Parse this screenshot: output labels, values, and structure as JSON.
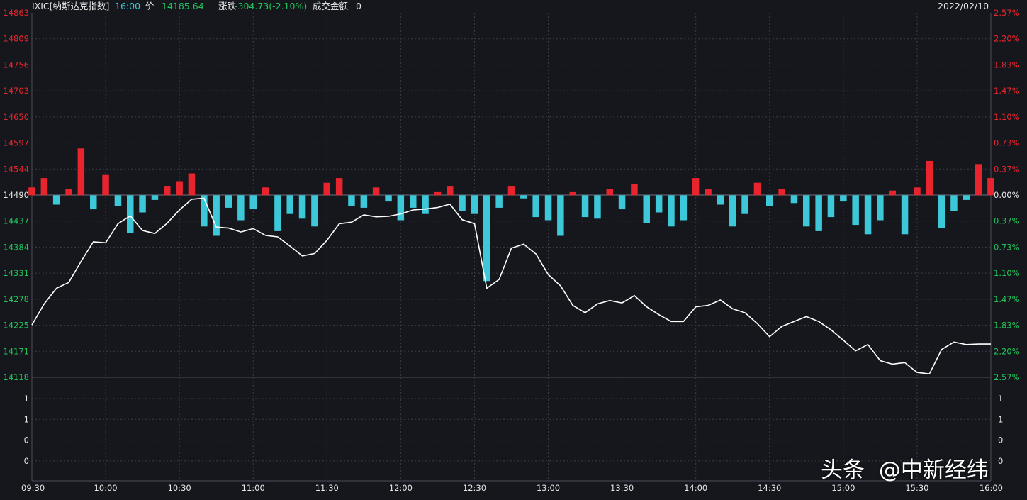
{
  "header": {
    "symbol": "IXIC[纳斯达克指数]",
    "time": "16:00",
    "price_label": "价",
    "price": "14185.64",
    "change_label": "涨跌",
    "change": "-304.73(-2.10%)",
    "turnover_label": "成交金额",
    "turnover": "0",
    "date": "2022/02/10"
  },
  "watermark": {
    "brand": "头条",
    "author": "@中新经纬"
  },
  "colors": {
    "background": "#15171c",
    "up": "#e8252e",
    "down": "#3cc8d8",
    "price_line": "#ffffff",
    "rise_text": "#e8252e",
    "fall_text": "#21c45a",
    "grid": "#3a3f48"
  },
  "chart_data": {
    "type": "line",
    "title": "IXIC[纳斯达克指数]",
    "prev_close": 14490,
    "ylim": [
      14118,
      14863
    ],
    "y_ticks": [
      "14863",
      "14809",
      "14756",
      "14703",
      "14650",
      "14597",
      "14544",
      "14490",
      "14437",
      "14384",
      "14331",
      "14278",
      "14225",
      "14171",
      "14118"
    ],
    "pct_ticks": [
      "2.57%",
      "2.20%",
      "1.83%",
      "1.47%",
      "1.10%",
      "0.73%",
      "0.37%",
      "0.00%",
      "0.37%",
      "0.73%",
      "1.10%",
      "1.47%",
      "1.83%",
      "2.20%",
      "2.57%"
    ],
    "x_ticks": [
      "09:30",
      "10:00",
      "10:30",
      "11:00",
      "11:30",
      "12:00",
      "12:30",
      "13:00",
      "13:30",
      "14:00",
      "14:30",
      "15:00",
      "15:30",
      "16:00"
    ],
    "volume_ticks": [
      "1",
      "1",
      "0",
      "0"
    ],
    "grid": true,
    "series": [
      {
        "x": [
          "09:30",
          "09:35",
          "09:40",
          "09:45",
          "09:50",
          "09:55",
          "10:00",
          "10:05",
          "10:10",
          "10:15",
          "10:20",
          "10:25",
          "10:30",
          "10:35",
          "10:40",
          "10:45",
          "10:50",
          "10:55",
          "11:00",
          "11:05",
          "11:10",
          "11:15",
          "11:20",
          "11:25",
          "11:30",
          "11:35",
          "11:40",
          "11:45",
          "11:50",
          "11:55",
          "12:00",
          "12:05",
          "12:10",
          "12:15",
          "12:20",
          "12:25",
          "12:30",
          "12:35",
          "12:40",
          "12:45",
          "12:50",
          "12:55",
          "13:00",
          "13:05",
          "13:10",
          "13:15",
          "13:20",
          "13:25",
          "13:30",
          "13:35",
          "13:40",
          "13:45",
          "13:50",
          "13:55",
          "14:00",
          "14:05",
          "14:10",
          "14:15",
          "14:20",
          "14:25",
          "14:30",
          "14:35",
          "14:40",
          "14:45",
          "14:50",
          "14:55",
          "15:00",
          "15:05",
          "15:10",
          "15:15",
          "15:20",
          "15:25",
          "15:30",
          "15:35",
          "15:40",
          "15:45",
          "15:50",
          "15:55",
          "16:00"
        ],
        "values": [
          14225,
          14268,
          14300,
          14312,
          14355,
          14395,
          14393,
          14432,
          14448,
          14418,
          14412,
          14433,
          14460,
          14482,
          14484,
          14425,
          14423,
          14415,
          14422,
          14408,
          14405,
          14386,
          14366,
          14371,
          14398,
          14432,
          14435,
          14450,
          14446,
          14447,
          14452,
          14460,
          14462,
          14465,
          14472,
          14440,
          14432,
          14300,
          14318,
          14382,
          14390,
          14370,
          14328,
          14305,
          14265,
          14250,
          14268,
          14275,
          14270,
          14285,
          14262,
          14246,
          14232,
          14232,
          14262,
          14265,
          14276,
          14258,
          14250,
          14228,
          14201,
          14222,
          14232,
          14242,
          14232,
          14215,
          14194,
          14172,
          14185,
          14152,
          14145,
          14148,
          14128,
          14125,
          14175,
          14190,
          14185,
          14186,
          14186
        ],
        "color": "#ffffff"
      },
      {
        "x": [
          "09:30",
          "09:35",
          "09:40",
          "09:45",
          "09:50",
          "09:55",
          "10:00",
          "10:05",
          "10:10",
          "10:15",
          "10:20",
          "10:25",
          "10:30",
          "10:35",
          "10:40",
          "10:45",
          "10:50",
          "10:55",
          "11:00",
          "11:05",
          "11:10",
          "11:15",
          "11:20",
          "11:25",
          "11:30",
          "11:35",
          "11:40",
          "11:45",
          "11:50",
          "11:55",
          "12:00",
          "12:05",
          "12:10",
          "12:15",
          "12:20",
          "12:25",
          "12:30",
          "12:35",
          "12:40",
          "12:45",
          "12:50",
          "12:55",
          "13:00",
          "13:05",
          "13:10",
          "13:15",
          "13:20",
          "13:25",
          "13:30",
          "13:35",
          "13:40",
          "13:45",
          "13:50",
          "13:55",
          "14:00",
          "14:05",
          "14:10",
          "14:15",
          "14:20",
          "14:25",
          "14:30",
          "14:35",
          "14:40",
          "14:45",
          "14:50",
          "14:55",
          "15:00",
          "15:05",
          "15:10",
          "15:15",
          "15:20",
          "15:25",
          "15:30",
          "15:35",
          "15:40",
          "15:45",
          "15:50",
          "15:55",
          "16:00"
        ],
        "values": [
          10,
          22,
          -12,
          8,
          60,
          -18,
          26,
          -14,
          -48,
          -22,
          -6,
          12,
          18,
          28,
          -40,
          -52,
          -16,
          -32,
          -18,
          10,
          -46,
          -24,
          -30,
          -40,
          16,
          22,
          -14,
          -16,
          10,
          -8,
          -32,
          -16,
          -24,
          4,
          12,
          -20,
          -24,
          -110,
          -16,
          12,
          -4,
          -28,
          -32,
          -52,
          4,
          -28,
          -30,
          8,
          -18,
          14,
          -36,
          -22,
          -40,
          -32,
          22,
          8,
          -12,
          -40,
          -24,
          16,
          -14,
          8,
          -10,
          -40,
          -46,
          -28,
          -8,
          -38,
          -50,
          -32,
          6,
          -50,
          10,
          44,
          -42,
          -20,
          -6,
          40,
          22
        ],
        "color": "#e8252e"
      }
    ]
  }
}
